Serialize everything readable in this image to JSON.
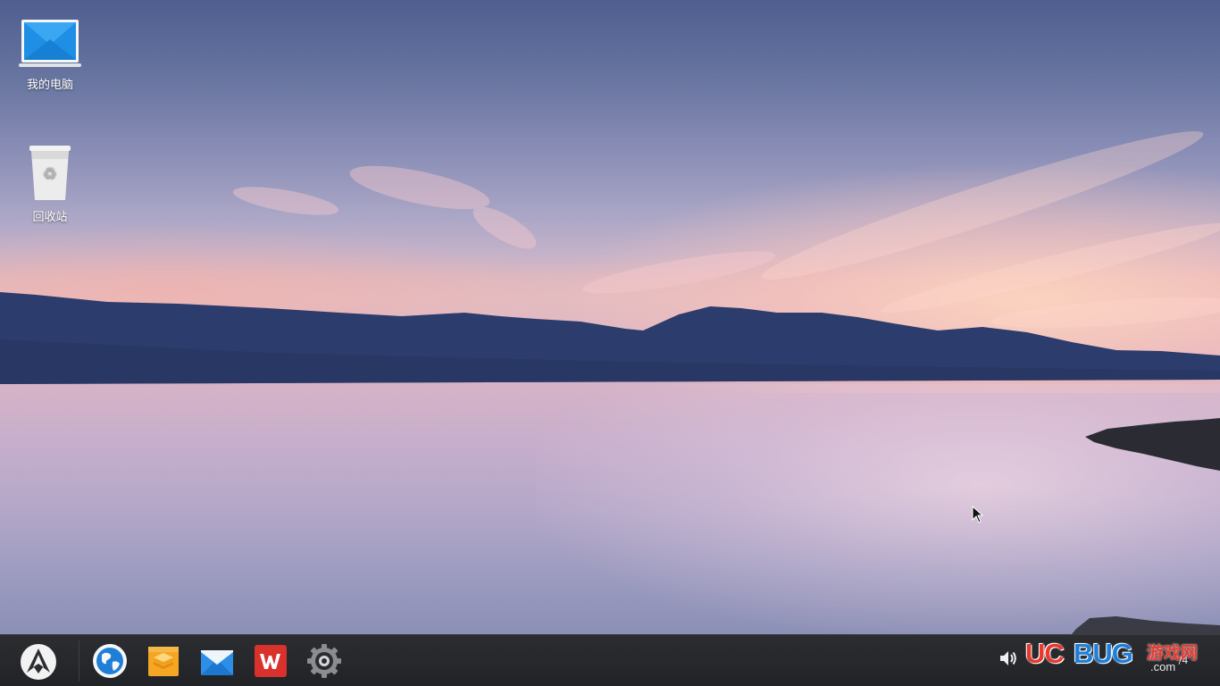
{
  "desktop": {
    "icons": [
      {
        "label": "我的电脑",
        "icon": "laptop-icon"
      },
      {
        "label": "回收站",
        "icon": "trash-bin-icon"
      }
    ]
  },
  "taskbar": {
    "launcher_icon": "launcher-logo-icon",
    "apps": [
      {
        "name": "browser",
        "icon": "globe-icon"
      },
      {
        "name": "files",
        "icon": "folder-stack-icon"
      },
      {
        "name": "mail",
        "icon": "mail-icon"
      },
      {
        "name": "office",
        "icon": "wps-office-icon"
      },
      {
        "name": "settings",
        "icon": "gear-icon"
      }
    ],
    "tray": {
      "volume_icon": "speaker-icon"
    },
    "clock_date": "/4"
  },
  "watermark": {
    "brand_red": "UC",
    "brand_blue": "BUG",
    "brand_cn": "游戏网",
    "brand_domain": ".com"
  },
  "colors": {
    "taskbar_bg": "#25262a",
    "brand_red": "#e8392f",
    "brand_blue": "#1e7fd8"
  }
}
